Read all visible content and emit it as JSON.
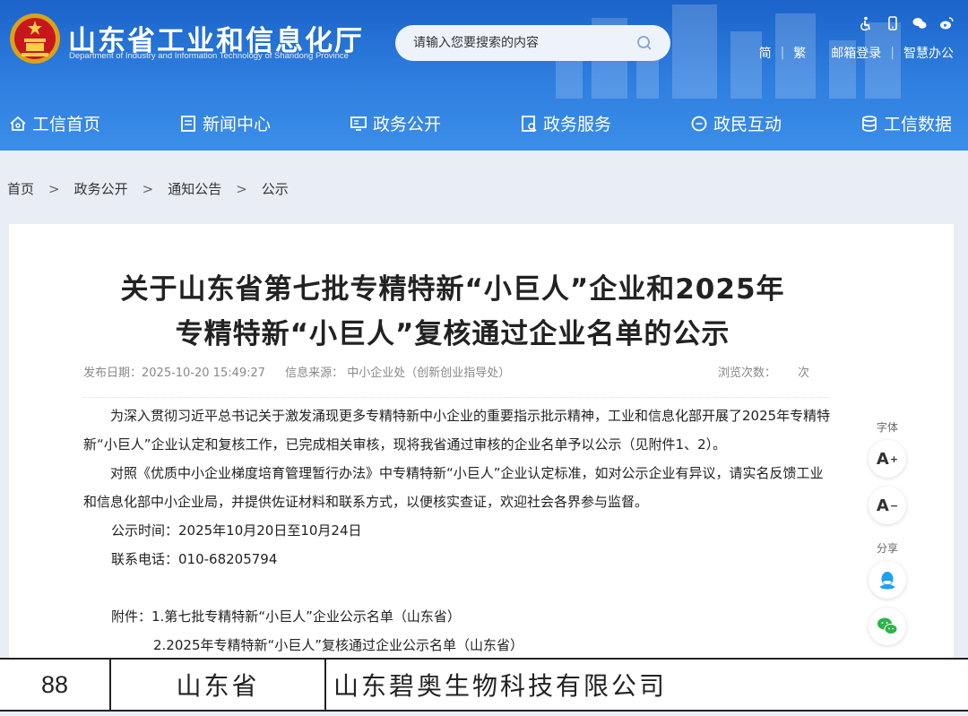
{
  "header": {
    "site_title": "山东省工业和信息化厅",
    "site_subtitle": "Department of Industry and Information Technology of Shandong Province",
    "search_placeholder": "请输入您要搜索的内容",
    "top_links": [
      "简",
      "繁",
      "邮箱登录",
      "智慧办公"
    ],
    "accent": "#2b76d9"
  },
  "nav": [
    "工信首页",
    "新闻中心",
    "政务公开",
    "政务服务",
    "政民互动",
    "工信数据"
  ],
  "breadcrumb": [
    "首页",
    "政务公开",
    "通知公告",
    "公示"
  ],
  "article": {
    "title_line1": "关于山东省第七批专精特新“小巨人”企业和2025年",
    "title_line2": "专精特新“小巨人”复核通过企业名单的公示",
    "publish_date": "发布日期：2025-10-20 15:49:27",
    "source": "信息来源：  中小企业处（创新创业指导处）",
    "views_label": "浏览次数：",
    "views_unit": "次",
    "para1": "为深入贯彻习近平总书记关于激发涌现更多专精特新中小企业的重要指示批示精神，工业和信息化部开展了2025年专精特新“小巨人”企业认定和复核工作，已完成相关审核，现将我省通过审核的企业名单予以公示（见附件1、2）。",
    "para2": "对照《优质中小企业梯度培育管理暂行办法》中专精特新“小巨人”企业认定标准，如对公示企业有异议，请实名反馈工业和信息化部中小企业局，并提供佐证材料和联系方式，以便核实查证，欢迎社会各界参与监督。",
    "period": "公示时间：2025年10月20日至10月24日",
    "phone": "联系电话：010-68205794",
    "attach1": "附件：1.第七批专精特新“小巨人”企业公示名单（山东省）",
    "attach2": "2.2025年专精特新“小巨人”复核通过企业公示名单（山东省）"
  },
  "side": {
    "font_label": "字体",
    "font_up": "A",
    "font_up_sign": "+",
    "font_down": "A",
    "font_down_sign": "−",
    "share_label": "分享"
  },
  "table_row": {
    "index": "88",
    "province": "山东省",
    "company": "山东碧奥生物科技有限公司"
  }
}
